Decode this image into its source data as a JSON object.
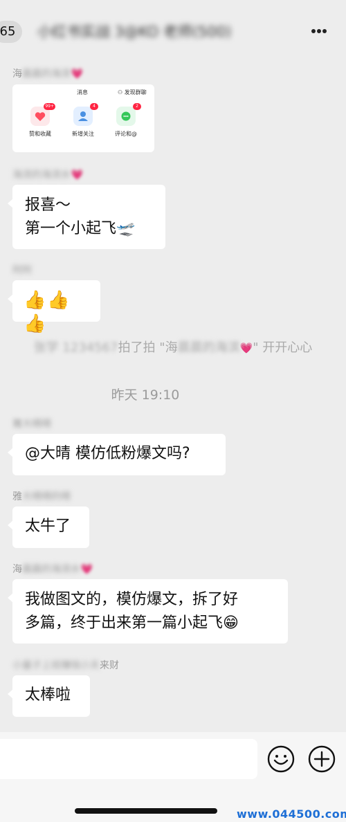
{
  "header": {
    "unread_count": "65",
    "title": "小红书实战 3@KO 老师(500)",
    "more_icon": "more-dots-icon"
  },
  "messages": [
    {
      "sender": "海",
      "sender_blurred": "晨晨的海滨",
      "heart": "💗",
      "type": "card",
      "card": {
        "tab_messages": "消息",
        "tab_discover": "发现群聊",
        "items": [
          {
            "label": "赞和收藏",
            "badge": "99+",
            "color": "#ff4d5f",
            "bg": "#fde8ea",
            "icon": "heart-icon"
          },
          {
            "label": "新增关注",
            "badge": "4",
            "color": "#4a90e2",
            "bg": "#e3efff",
            "icon": "person-icon"
          },
          {
            "label": "评论和@",
            "badge": "2",
            "color": "#34c759",
            "bg": "#e4f8ea",
            "icon": "comment-icon"
          }
        ]
      }
    },
    {
      "sender_blurred": "海滨的海滨水",
      "heart": "💗",
      "type": "text",
      "lines": [
        "报喜～",
        "第一个小起飞🛫"
      ]
    },
    {
      "sender_blurred": "阿阿",
      "type": "text",
      "text": "👍👍👍"
    },
    {
      "sender": "雅",
      "sender_blurred": "大晴晴",
      "type": "text",
      "text": "@大晴 模仿低粉爆文吗?"
    },
    {
      "sender": "雅",
      "sender_blurred": "大晴晴的晴",
      "type": "text",
      "text": "太牛了"
    },
    {
      "sender": "海",
      "sender_blurred": "晨晨的海滨水",
      "heart": "💗",
      "type": "text",
      "lines": [
        "我做图文的，模仿爆文，拆了好",
        "多篇，终于出来第一篇小起飞😁"
      ]
    },
    {
      "sender_blurred": "小量子上班赚钱小天",
      "sender_suffix": "来财",
      "type": "text",
      "text": "太棒啦"
    }
  ],
  "system_notice": {
    "prefix_blurred": "张学 1234567",
    "action": "拍了拍 \"海",
    "target_blurred": "晨晨的海滨",
    "heart": "💗",
    "suffix": "\" 开开心心"
  },
  "timestamp": "昨天 19:10",
  "input_bar": {
    "placeholder": "",
    "emoji_icon": "emoji-icon",
    "plus_icon": "plus-circle-icon"
  },
  "watermark": "www.044500.com"
}
